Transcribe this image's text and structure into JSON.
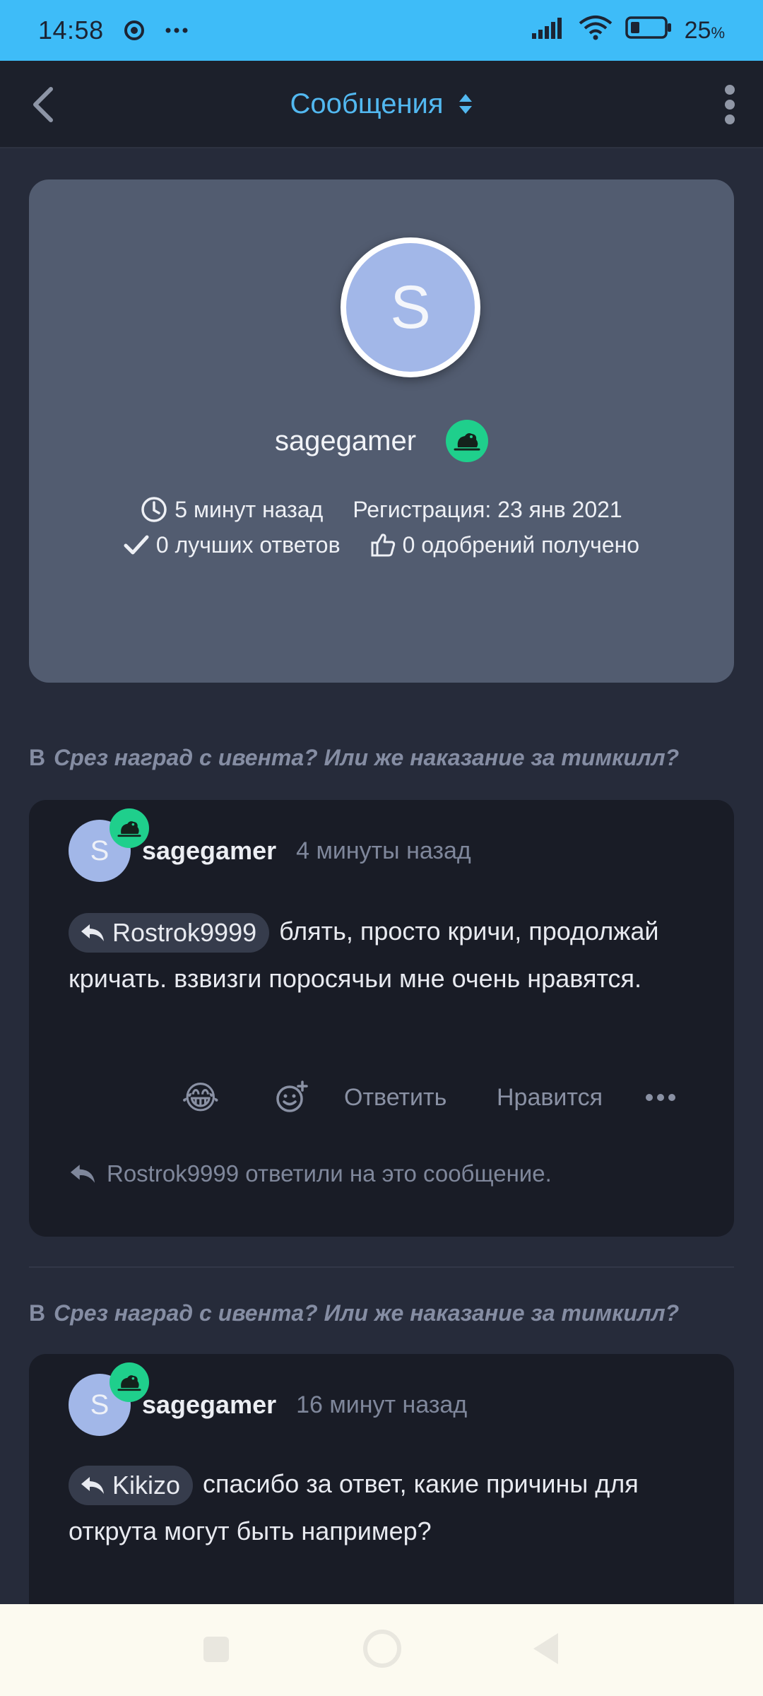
{
  "status_bar": {
    "time": "14:58",
    "battery": "25",
    "battery_unit": "%",
    "icons": [
      "chrome-icon",
      "more-dots-icon",
      "signal-icon",
      "wifi-icon",
      "battery-icon"
    ]
  },
  "header": {
    "title": "Сообщения"
  },
  "profile": {
    "avatar_letter": "S",
    "username": "sagegamer",
    "last_seen": "5 минут назад",
    "registration": "Регистрация: 23 янв 2021",
    "best_answers": "0 лучших ответов",
    "likes": "0 одобрений получено"
  },
  "posts": [
    {
      "thread_prefix": "В",
      "thread_title": "Срез наград с ивента? Или же наказание за тимкилл?",
      "avatar_letter": "S",
      "author": "sagegamer",
      "time": "4 минуты назад",
      "mention": "Rostrok9999",
      "text": "блять, просто кричи, продолжай кричать. взвизги поросячьи мне очень нравятся.",
      "reaction_emoji": "😂",
      "reply_label": "Ответить",
      "like_label": "Нравится",
      "reply_note": "Rostrok9999 ответили на это сообщение."
    },
    {
      "thread_prefix": "В",
      "thread_title": "Срез наград с ивента? Или же наказание за тимкилл?",
      "avatar_letter": "S",
      "author": "sagegamer",
      "time": "16 минут назад",
      "mention": "Kikizo",
      "text": "спасибо за ответ, какие причины для открута могут быть например?"
    }
  ],
  "colors": {
    "status_bar": "#3ebcf8",
    "accent": "#52b8f0",
    "badge": "#1fcf8c",
    "card": "#525c70",
    "post": "#191c26"
  }
}
